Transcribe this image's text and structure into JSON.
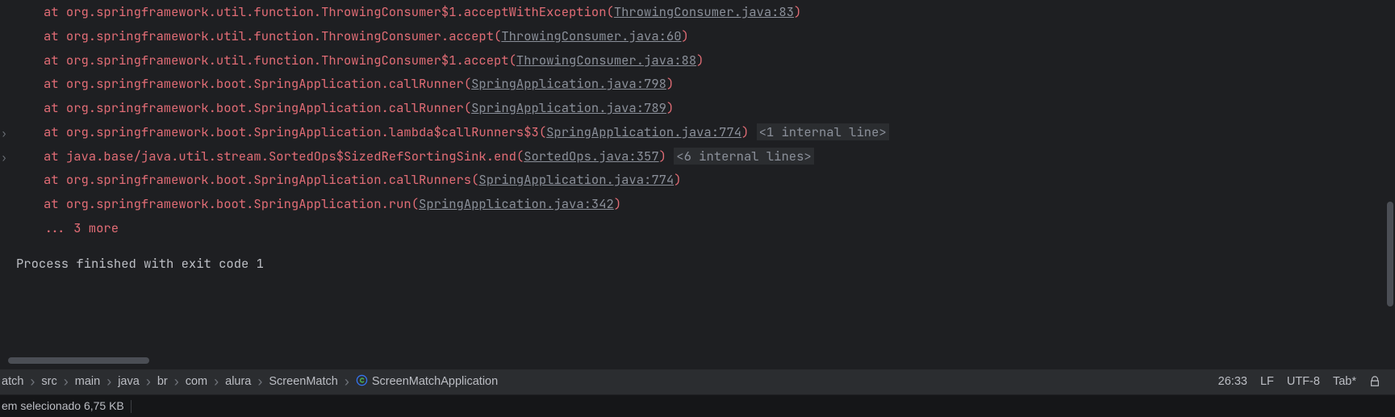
{
  "stack": [
    {
      "method": "org.springframework.util.function.ThrowingConsumer$1.acceptWithException",
      "src": "ThrowingConsumer.java:83",
      "internal": null,
      "expandable": false
    },
    {
      "method": "org.springframework.util.function.ThrowingConsumer.accept",
      "src": "ThrowingConsumer.java:60",
      "internal": null,
      "expandable": false
    },
    {
      "method": "org.springframework.util.function.ThrowingConsumer$1.accept",
      "src": "ThrowingConsumer.java:88",
      "internal": null,
      "expandable": false
    },
    {
      "method": "org.springframework.boot.SpringApplication.callRunner",
      "src": "SpringApplication.java:798",
      "internal": null,
      "expandable": false
    },
    {
      "method": "org.springframework.boot.SpringApplication.callRunner",
      "src": "SpringApplication.java:789",
      "internal": null,
      "expandable": false
    },
    {
      "method": "org.springframework.boot.SpringApplication.lambda$callRunners$3",
      "src": "SpringApplication.java:774",
      "internal": "<1 internal line>",
      "expandable": true
    },
    {
      "method": "java.base/java.util.stream.SortedOps$SizedRefSortingSink.end",
      "src": "SortedOps.java:357",
      "internal": "<6 internal lines>",
      "expandable": true
    },
    {
      "method": "org.springframework.boot.SpringApplication.callRunners",
      "src": "SpringApplication.java:774",
      "internal": null,
      "expandable": false
    },
    {
      "method": "org.springframework.boot.SpringApplication.run",
      "src": "SpringApplication.java:342",
      "internal": null,
      "expandable": false
    }
  ],
  "more_text": "... 3 more",
  "process_exit": "Process finished with exit code 1",
  "at_prefix": "at ",
  "breadcrumbs": [
    "atch",
    "src",
    "main",
    "java",
    "br",
    "com",
    "alura",
    "ScreenMatch",
    "ScreenMatchApplication"
  ],
  "status": {
    "cursor": "26:33",
    "line_sep": "LF",
    "encoding": "UTF-8",
    "indent": "Tab*"
  },
  "bottom": {
    "selection": "em selecionado  6,75 KB"
  }
}
